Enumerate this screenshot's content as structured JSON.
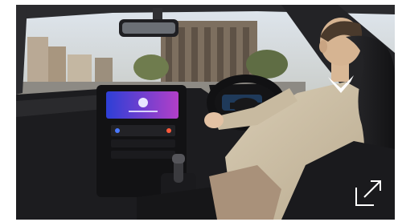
{
  "image": {
    "subject": "car-interior-driver",
    "alt_text": ""
  },
  "controls": {
    "expand_icon": "expand-arrow-icon"
  },
  "colors": {
    "screen_gradient_start": "#2d3fd6",
    "screen_gradient_end": "#b23fc8",
    "dashboard": "#1c1c1f",
    "beige_jacket": "#cfc2a8",
    "expand_icon_stroke": "#ffffff"
  }
}
